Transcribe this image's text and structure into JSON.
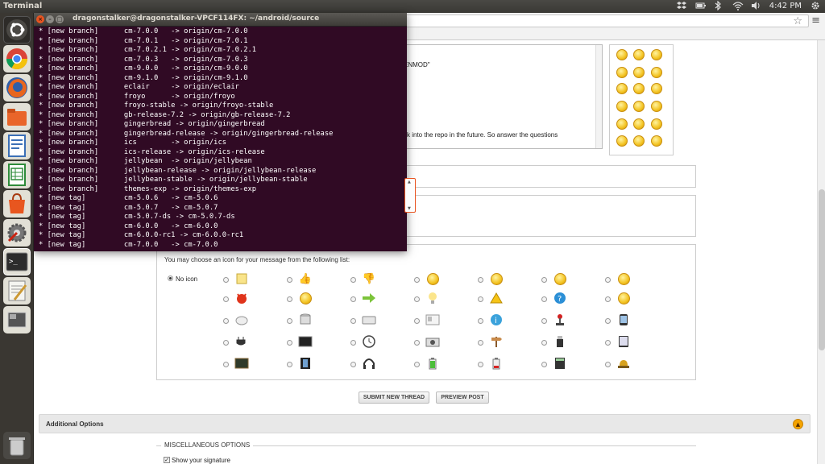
{
  "top_panel": {
    "app_title": "Terminal",
    "clock": "4:42 PM",
    "indicators": [
      "dropbox-icon",
      "battery-icon",
      "bluetooth-icon",
      "wifi-icon",
      "volume-icon",
      "gear-icon"
    ]
  },
  "launcher": {
    "items": [
      "ubuntu-logo-icon",
      "chrome-icon",
      "firefox-icon",
      "files-icon",
      "writer-icon",
      "calc-icon",
      "software-center-icon",
      "system-settings-icon",
      "terminal-icon",
      "text-editor-icon",
      "workspace-switcher-icon",
      "trash-icon"
    ]
  },
  "terminal": {
    "title": "dragonstalker@dragonstalker-VPCF114FX: ~/android/source",
    "lines": [
      "* [new branch]      cm-7.0.0   -> origin/cm-7.0.0",
      "* [new branch]      cm-7.0.1   -> origin/cm-7.0.1",
      "* [new branch]      cm-7.0.2.1 -> origin/cm-7.0.2.1",
      "* [new branch]      cm-7.0.3   -> origin/cm-7.0.3",
      "* [new branch]      cm-9.0.0   -> origin/cm-9.0.0",
      "* [new branch]      cm-9.1.0   -> origin/cm-9.1.0",
      "* [new branch]      eclair     -> origin/eclair",
      "* [new branch]      froyo      -> origin/froyo",
      "* [new branch]      froyo-stable -> origin/froyo-stable",
      "* [new branch]      gb-release-7.2 -> origin/gb-release-7.2",
      "* [new branch]      gingerbread -> origin/gingerbread",
      "* [new branch]      gingerbread-release -> origin/gingerbread-release",
      "* [new branch]      ics        -> origin/ics",
      "* [new branch]      ics-release -> origin/ics-release",
      "* [new branch]      jellybean  -> origin/jellybean",
      "* [new branch]      jellybean-release -> origin/jellybean-release",
      "* [new branch]      jellybean-stable -> origin/jellybean-stable",
      "* [new branch]      themes-exp -> origin/themes-exp",
      "* [new tag]         cm-5.0.6   -> cm-5.0.6",
      "* [new tag]         cm-5.0.7   -> cm-5.0.7",
      "* [new tag]         cm-5.0.7-ds -> cm-5.0.7-ds",
      "* [new tag]         cm-6.0.0   -> cm-6.0.0",
      "* [new tag]         cm-6.0.0-rc1 -> cm-6.0.0-rc1",
      "* [new tag]         cm-7.0.0   -> cm-7.0.0"
    ]
  },
  "editor": {
    "line1": "ENMOD\"",
    "line2": "ck into the repo in the future.  So answer the questions"
  },
  "icon_panel": {
    "hint": "You may choose an icon for your message from the following list:",
    "no_icon_label": "No icon"
  },
  "buttons": {
    "submit": "SUBMIT NEW THREAD",
    "preview": "PREVIEW POST"
  },
  "additional_options": {
    "title": "Additional Options"
  },
  "misc": {
    "legend": "MISCELLANEOUS OPTIONS",
    "show_signature": "Show your signature"
  }
}
